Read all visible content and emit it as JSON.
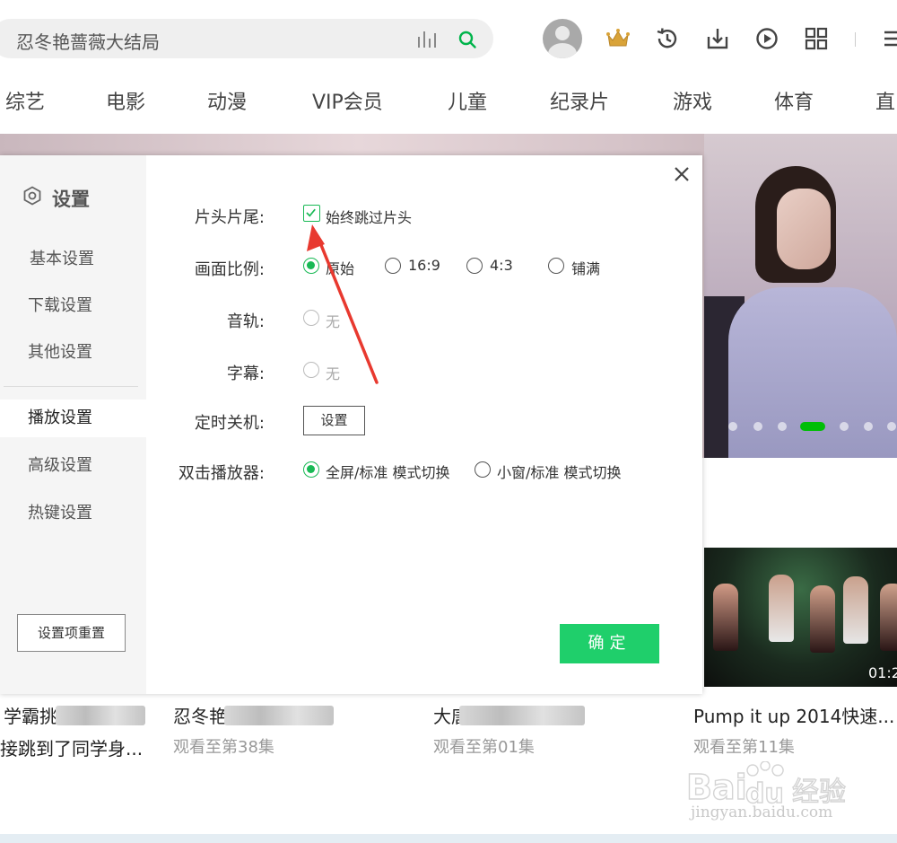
{
  "search": {
    "value": "忍冬艳蔷薇大结局"
  },
  "nav": {
    "items": [
      "综艺",
      "电影",
      "动漫",
      "VIP会员",
      "儿童",
      "纪录片",
      "游戏",
      "体育",
      "直"
    ]
  },
  "dialog": {
    "title": "设置",
    "sidebar": [
      "基本设置",
      "下载设置",
      "其他设置",
      "播放设置",
      "高级设置",
      "热键设置"
    ],
    "active_item": "播放设置",
    "reset_label": "设置项重置",
    "confirm_label": "确定",
    "rows": {
      "intro_outro": {
        "label": "片头片尾:",
        "checkbox_label": "始终跳过片头",
        "checked": true
      },
      "aspect": {
        "label": "画面比例:",
        "options": [
          "原始",
          "16:9",
          "4:3",
          "铺满"
        ],
        "selected": "原始"
      },
      "audio": {
        "label": "音轨:",
        "option": "无"
      },
      "subtitle": {
        "label": "字幕:",
        "option": "无"
      },
      "timer": {
        "label": "定时关机:",
        "button": "设置"
      },
      "doubleclick": {
        "label": "双击播放器:",
        "options": [
          "全屏/标准 模式切换",
          "小窗/标准 模式切换"
        ],
        "selected": "全屏/标准 模式切换"
      }
    }
  },
  "video_duration": "01:2",
  "cards": [
    {
      "title": "学霸挑战跳山羊",
      "title2": "接跳到了同学身...",
      "subtitle": ""
    },
    {
      "title": "忍冬艳蔷薇第38集",
      "subtitle": "观看至第38集"
    },
    {
      "title": "大唐女法医第1集",
      "subtitle": "观看至第01集"
    },
    {
      "title": "Pump it up 2014快速...",
      "subtitle": "观看至第11集"
    }
  ],
  "watermark": {
    "url": "jingyan.baidu.com"
  },
  "colors": {
    "accent": "#19b955",
    "confirm": "#1fcf6b",
    "carousel_active": "#00be06"
  }
}
